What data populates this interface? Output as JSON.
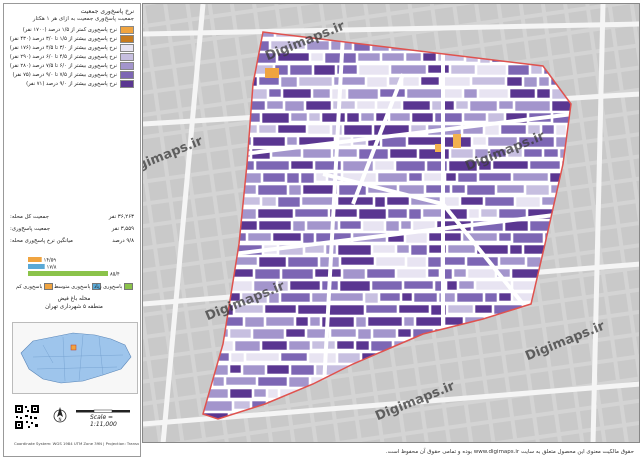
{
  "legend": {
    "title": "نرخ پاسخ‌وری جمعیت",
    "subtitle": "جمعیت پاسخ‌وری جمعیت به ازای هر ۱ هکتار",
    "classes": [
      {
        "label": "نرخ پاسخ‌وری کمتر از ۱/۵ درصد (۱۷۰۰ نفر)",
        "color": "#f0a440"
      },
      {
        "label": "نرخ پاسخ‌وری بیشتر از ۱/۵ تا ۳/۰ درصد (۴۳۰ نفر)",
        "color": "#c67a1e"
      },
      {
        "label": "نرخ پاسخ‌وری بیشتر از ۳/۰ تا ۴/۵ درصد (۱۷۶ نفر)",
        "color": "#e8e4f2"
      },
      {
        "label": "نرخ پاسخ‌وری بیشتر از ۴/۵ تا ۶/۰ درصد (۲۹۰ نفر)",
        "color": "#c7bfe0"
      },
      {
        "label": "نرخ پاسخ‌وری بیشتر از ۶/۰ تا ۷/۵ درصد (۲۸۰ نفر)",
        "color": "#a395cc"
      },
      {
        "label": "نرخ پاسخ‌وری بیشتر از ۷/۵ تا ۹/۰ درصد (۷۵ نفر)",
        "color": "#7d66b4"
      },
      {
        "label": "نرخ پاسخ‌وری بیشتر از ۹/۰ درصد (۷۱ نفر)",
        "color": "#5a3691"
      }
    ]
  },
  "stats": [
    {
      "label": "جمعیت کل محله:",
      "value": "۳۶,۲۶۳ نفر"
    },
    {
      "label": "جمعیت پاسخ‌وری:",
      "value": "۳,۵۵۹ نفر"
    },
    {
      "label": "میانگین نرخ پاسخ‌وری محله:",
      "value": "۹/۸ درصد"
    }
  ],
  "chart_data": {
    "type": "bar",
    "categories": [
      "پاسخ‌وری کم",
      "پاسخ‌وری متوسط",
      "پاسخ‌وری زیاد"
    ],
    "series": [
      {
        "values": [
          14.59,
          17.8,
          85.4
        ]
      }
    ],
    "value_labels": [
      "۱۴/۵۹",
      "۱۷/۸",
      "۸۵/۴"
    ],
    "colors": [
      "#f0a440",
      "#5aa9d6",
      "#8bc34a"
    ]
  },
  "categories_legend": [
    {
      "label": "پاسخ‌وری کم",
      "color": "#f0a440"
    },
    {
      "label": "پاسخ‌وری متوسط",
      "color": "#5aa9d6"
    },
    {
      "label": "پاسخ‌وری زیاد",
      "color": "#8bc34a"
    }
  ],
  "region": {
    "line1": "محله باغ فیض",
    "line2": "منطقه ۵ شهرداری تهران"
  },
  "scale": {
    "label": "Scale = 1:11,000",
    "ticks": [
      "0",
      "100",
      "200"
    ]
  },
  "projection": "Coordinate System: WGS 1984 UTM Zone 39N | Projection: Transverse Mercator",
  "watermark": "Digimaps.ir",
  "footer": "حقوق مالکیت معنوی این محصول متعلق به سایت www.digimaps.ir بوده و تمامی حقوق آن محفوظ است.",
  "colors": {
    "boundary": "#e0524e",
    "road": "#ffffff",
    "background_map": "#d7d7d7"
  }
}
